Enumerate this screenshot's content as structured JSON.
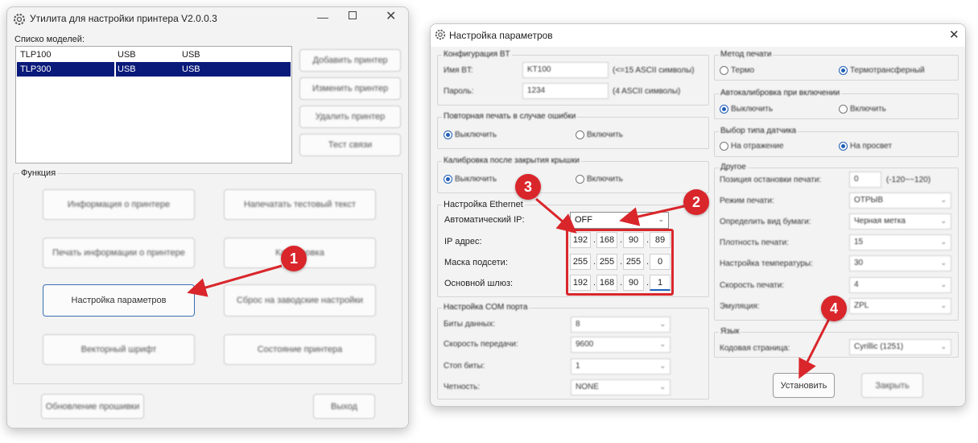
{
  "colors": {
    "accent": "#1f5fb5",
    "selection": "#0a1a7a",
    "annotation": "#d9262b"
  },
  "main_window": {
    "title": "Утилита для настройки принтера  V2.0.0.3",
    "models_label": "Списко моделей:",
    "models": [
      {
        "name": "TLP100",
        "col2": "USB",
        "col3": "USB"
      },
      {
        "name": "TLP300",
        "col2": "USB",
        "col3": "USB"
      }
    ],
    "side_buttons": [
      "Добавить принтер",
      "Изменить принтер",
      "Удалить принтер",
      "Тест связи"
    ],
    "function_label": "Функция",
    "function_buttons": [
      "Информация о принтере",
      "Напечатать тестовый текст",
      "Печать информации о принтере",
      "Калибровка",
      "Настройка параметров",
      "Сброс на заводские настройки",
      "Векторный шрифт",
      "Состояние принтера"
    ],
    "update_button": "Обновление прошивки",
    "exit_button": "Выход"
  },
  "dialog": {
    "title": "Настройка параметров",
    "bt": {
      "label": "Конфигурация BT",
      "name_label": "Имя BT:",
      "name_value": "KT100",
      "name_hint": "(<=15 ASCII символы)",
      "pass_label": "Пароль:",
      "pass_value": "1234",
      "pass_hint": "(4 ASCII символы)"
    },
    "reprint": {
      "label": "Повторная печать в случае ошибки",
      "opt1": "Выключить",
      "opt2": "Включить"
    },
    "calib_after_cover": {
      "label": "Калибровка после закрытия крышки",
      "opt1": "Выключить",
      "opt2": "Включить"
    },
    "ethernet": {
      "label": "Настройка Ethernet",
      "auto_ip_label": "Автоматический IP:",
      "auto_ip_value": "OFF",
      "ip_label": "IP адрес:",
      "ip": [
        "192",
        "168",
        "90",
        "89"
      ],
      "mask_label": "Маска подсети:",
      "mask": [
        "255",
        "255",
        "255",
        "0"
      ],
      "gw_label": "Основной шлюз:",
      "gw": [
        "192",
        "168",
        "90",
        "1"
      ]
    },
    "com": {
      "label": "Настройка COM порта",
      "rows": [
        {
          "label": "Биты данных:",
          "value": "8"
        },
        {
          "label": "Скорость передачи:",
          "value": "9600"
        },
        {
          "label": "Стоп биты:",
          "value": "1"
        },
        {
          "label": "Четность:",
          "value": "NONE"
        }
      ]
    },
    "print_method": {
      "label": "Метод печати",
      "opt1": "Термо",
      "opt2": "Термотрансферный"
    },
    "auto_calib": {
      "label": "Автокалибровка при включении",
      "opt1": "Выключить",
      "opt2": "Включить"
    },
    "sensor": {
      "label": "Выбор типа датчика",
      "opt1": "На отражение",
      "opt2": "На просвет"
    },
    "other": {
      "label": "Другое",
      "offset_label": "Позиция остановки печати:",
      "offset_value": "0",
      "offset_hint": "(-120~~120)",
      "rows": [
        {
          "label": "Режим печати:",
          "value": "ОТРЫВ"
        },
        {
          "label": "Определить вид бумаги:",
          "value": "Черная метка"
        },
        {
          "label": "Плотность печати:",
          "value": "15"
        },
        {
          "label": "Настройка температуры:",
          "value": "30"
        },
        {
          "label": "Скорость печати:",
          "value": "4"
        },
        {
          "label": "Эмуляция:",
          "value": "ZPL"
        }
      ]
    },
    "language": {
      "label": "Язык",
      "code_label": "Кодовая страница:",
      "code_value": "Cyrillic (1251)"
    },
    "apply_button": "Установить",
    "close_button": "Закрыть"
  },
  "annotations": [
    "1",
    "2",
    "3",
    "4"
  ]
}
